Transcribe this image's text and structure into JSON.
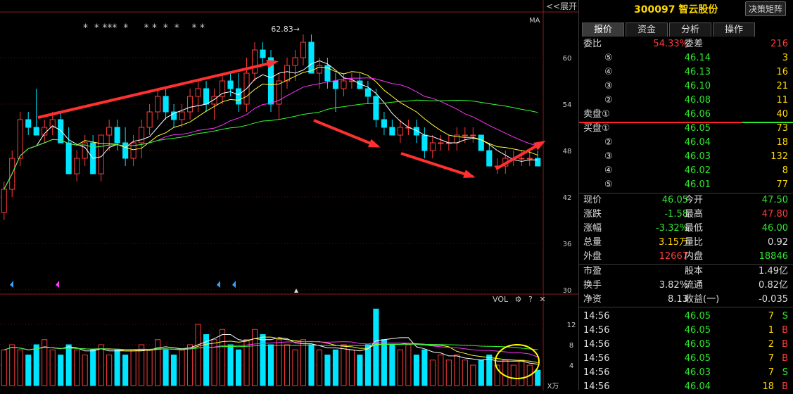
{
  "chart": {
    "expand_label": "<<展开",
    "ma_label": "MA",
    "stars": "*  * ***  *     * *  *  *    * *",
    "price_axis": [
      "60",
      "54",
      "48",
      "42",
      "36",
      "30"
    ],
    "vol_axis": [
      "12",
      "8",
      "4"
    ],
    "vol_unit": "X万",
    "max_label": "62.83",
    "vol_tools": {
      "label": "VOL",
      "gear": "⚙",
      "help": "?",
      "close": "✕"
    }
  },
  "chart_data": {
    "type": "candlestick",
    "ylim": [
      30,
      66
    ],
    "candles": [
      [
        40,
        44,
        39,
        43
      ],
      [
        43,
        48,
        42,
        47
      ],
      [
        47,
        53,
        46,
        52
      ],
      [
        52,
        53,
        50,
        51
      ],
      [
        51,
        56,
        50,
        50
      ],
      [
        50,
        52,
        49,
        51
      ],
      [
        51,
        53,
        50,
        52
      ],
      [
        52,
        53,
        49,
        49
      ],
      [
        49,
        51,
        45,
        45
      ],
      [
        45,
        48,
        44,
        47
      ],
      [
        47,
        50,
        46,
        49
      ],
      [
        49,
        50,
        45,
        45
      ],
      [
        45,
        50,
        44,
        50
      ],
      [
        50,
        52,
        48,
        51
      ],
      [
        51,
        52,
        48,
        49
      ],
      [
        49,
        51,
        46,
        47
      ],
      [
        47,
        50,
        46,
        49
      ],
      [
        49,
        52,
        47,
        51
      ],
      [
        51,
        54,
        50,
        53
      ],
      [
        53,
        56,
        52,
        55
      ],
      [
        55,
        56,
        52,
        53
      ],
      [
        53,
        54,
        51,
        52
      ],
      [
        52,
        54,
        51,
        53
      ],
      [
        53,
        56,
        52,
        55
      ],
      [
        55,
        57,
        53,
        56
      ],
      [
        56,
        57,
        53,
        54
      ],
      [
        54,
        56,
        52,
        55
      ],
      [
        55,
        58,
        54,
        57
      ],
      [
        57,
        58,
        55,
        56
      ],
      [
        56,
        58,
        53,
        54
      ],
      [
        54,
        60,
        53,
        58
      ],
      [
        58,
        62,
        57,
        61
      ],
      [
        61,
        62,
        59,
        60
      ],
      [
        60,
        61,
        53,
        54
      ],
      [
        54,
        58,
        52,
        57
      ],
      [
        57,
        60,
        56,
        59
      ],
      [
        59,
        61,
        57,
        60
      ],
      [
        60,
        63,
        59,
        62
      ],
      [
        62,
        63,
        58,
        58
      ],
      [
        58,
        60,
        56,
        59
      ],
      [
        59,
        60,
        56,
        57
      ],
      [
        57,
        58,
        53,
        56
      ],
      [
        56,
        58,
        55,
        57
      ],
      [
        57,
        58,
        56,
        57
      ],
      [
        57,
        58,
        56,
        56
      ],
      [
        56,
        57,
        54,
        55
      ],
      [
        55,
        56,
        51,
        52
      ],
      [
        52,
        53,
        50,
        51
      ],
      [
        51,
        52,
        50,
        50
      ],
      [
        50,
        52,
        49,
        51
      ],
      [
        51,
        52,
        50,
        51
      ],
      [
        51,
        52,
        49,
        50
      ],
      [
        50,
        51,
        47,
        48
      ],
      [
        48,
        50,
        47,
        49
      ],
      [
        49,
        50,
        48,
        49
      ],
      [
        49,
        50,
        48,
        49
      ],
      [
        49,
        51,
        48,
        50
      ],
      [
        50,
        51,
        49,
        50
      ],
      [
        50,
        51,
        49,
        50
      ],
      [
        50,
        50,
        48,
        48
      ],
      [
        48,
        49,
        46,
        46
      ],
      [
        46,
        47,
        45,
        46
      ],
      [
        46,
        48,
        45,
        47
      ],
      [
        47,
        48,
        46,
        47
      ],
      [
        47,
        48,
        46,
        47
      ],
      [
        47,
        48,
        46,
        47
      ],
      [
        47,
        48,
        46,
        46
      ]
    ],
    "volumes": [
      7,
      8,
      7,
      6,
      8,
      9,
      7,
      6,
      8,
      7,
      6,
      7,
      8,
      6,
      7,
      6,
      7,
      8,
      7,
      9,
      7,
      6,
      7,
      8,
      12,
      10,
      9,
      11,
      8,
      7,
      9,
      11,
      10,
      8,
      9,
      8,
      7,
      9,
      8,
      7,
      6,
      7,
      8,
      7,
      6,
      8,
      15,
      9,
      8,
      7,
      8,
      6,
      7,
      5,
      6,
      5,
      6,
      5,
      4,
      5,
      6,
      4,
      5,
      4,
      5,
      4,
      3
    ],
    "current_price": 46.05
  },
  "panel": {
    "title": "300097 智云股份",
    "decision_button": "决策矩阵",
    "tabs": [
      "报价",
      "资金",
      "分析",
      "操作"
    ],
    "weibi_label": "委比",
    "weibi_value": "54.33%",
    "weicha_label": "委差",
    "weicha_value": "216",
    "asks": [
      {
        "level": "⑤",
        "price": "46.14",
        "vol": "3"
      },
      {
        "level": "④",
        "price": "46.13",
        "vol": "16"
      },
      {
        "level": "③",
        "price": "46.10",
        "vol": "21"
      },
      {
        "level": "②",
        "price": "46.08",
        "vol": "11"
      },
      {
        "level": "卖盘①",
        "price": "46.06",
        "vol": "40"
      }
    ],
    "bids": [
      {
        "level": "买盘①",
        "price": "46.05",
        "vol": "73"
      },
      {
        "level": "②",
        "price": "46.04",
        "vol": "18"
      },
      {
        "level": "③",
        "price": "46.03",
        "vol": "132"
      },
      {
        "level": "④",
        "price": "46.02",
        "vol": "8"
      },
      {
        "level": "⑤",
        "price": "46.01",
        "vol": "77"
      }
    ],
    "stats": [
      {
        "l1": "现价",
        "v1": "46.05",
        "c1": "green",
        "l2": "今开",
        "v2": "47.50",
        "c2": "green"
      },
      {
        "l1": "涨跌",
        "v1": "-1.58",
        "c1": "green",
        "l2": "最高",
        "v2": "47.80",
        "c2": "red"
      },
      {
        "l1": "涨幅",
        "v1": "-3.32%",
        "c1": "green",
        "l2": "最低",
        "v2": "46.00",
        "c2": "green"
      },
      {
        "l1": "总量",
        "v1": "3.15万",
        "c1": "yellow",
        "l2": "量比",
        "v2": "0.92",
        "c2": "white"
      },
      {
        "l1": "外盘",
        "v1": "12667",
        "c1": "red",
        "l2": "内盘",
        "v2": "18846",
        "c2": "green"
      }
    ],
    "stats2": [
      {
        "l1": "市盈",
        "v1": "-",
        "c1": "white",
        "l2": "股本",
        "v2": "1.49亿",
        "c2": "white"
      },
      {
        "l1": "换手",
        "v1": "3.82%",
        "c1": "white",
        "l2": "流通",
        "v2": "0.82亿",
        "c2": "white"
      },
      {
        "l1": "净资",
        "v1": "8.13",
        "c1": "white",
        "l2": "收益(一)",
        "v2": "-0.035",
        "c2": "white"
      }
    ],
    "ticks": [
      {
        "time": "14:56",
        "price": "46.05",
        "vol": "7",
        "side": "S"
      },
      {
        "time": "14:56",
        "price": "46.05",
        "vol": "1",
        "side": "B"
      },
      {
        "time": "14:56",
        "price": "46.05",
        "vol": "2",
        "side": "B"
      },
      {
        "time": "14:56",
        "price": "46.05",
        "vol": "7",
        "side": "B"
      },
      {
        "time": "14:56",
        "price": "46.03",
        "vol": "7",
        "side": "S"
      },
      {
        "time": "14:56",
        "price": "46.04",
        "vol": "18",
        "side": "B"
      }
    ],
    "colors": {
      "up": "#ff3b3b",
      "down": "#00e5ff",
      "ask_line": "#ff2020",
      "bid_line": "#2ee82e"
    }
  }
}
